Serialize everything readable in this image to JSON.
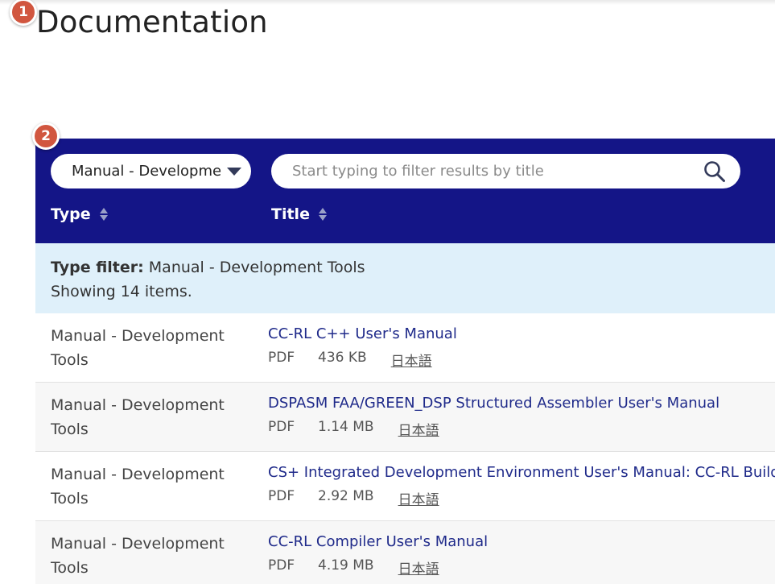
{
  "markers": {
    "m1": "1",
    "m2": "2"
  },
  "page": {
    "title": "Documentation"
  },
  "filters": {
    "type_select_value": "Manual - Development Tools",
    "search_placeholder": "Start typing to filter results by title",
    "columns": {
      "type": "Type",
      "title": "Title"
    }
  },
  "summary": {
    "label": "Type filter:",
    "value": "Manual - Development Tools",
    "count_text": "Showing 14 items."
  },
  "rows": [
    {
      "type": "Manual - Development Tools",
      "title": "CC-RL C++ User's Manual",
      "format": "PDF",
      "size": "436 KB",
      "lang": "日本語"
    },
    {
      "type": "Manual - Development Tools",
      "title": "DSPASM FAA/GREEN_DSP Structured Assembler User's Manual",
      "format": "PDF",
      "size": "1.14 MB",
      "lang": "日本語"
    },
    {
      "type": "Manual - Development Tools",
      "title": "CS+ Integrated Development Environment User's Manual: CC-RL Build Tool",
      "format": "PDF",
      "size": "2.92 MB",
      "lang": "日本語"
    },
    {
      "type": "Manual - Development Tools",
      "title": "CC-RL Compiler User's Manual",
      "format": "PDF",
      "size": "4.19 MB",
      "lang": "日本語"
    }
  ],
  "colors": {
    "panel": "#141587",
    "summary_bg": "#dff0fa",
    "link": "#1f2a8a",
    "marker": "#d1563f"
  },
  "icons": {
    "search": "search-icon",
    "sort": "sort-icon",
    "dropdown": "caret-down-icon"
  }
}
